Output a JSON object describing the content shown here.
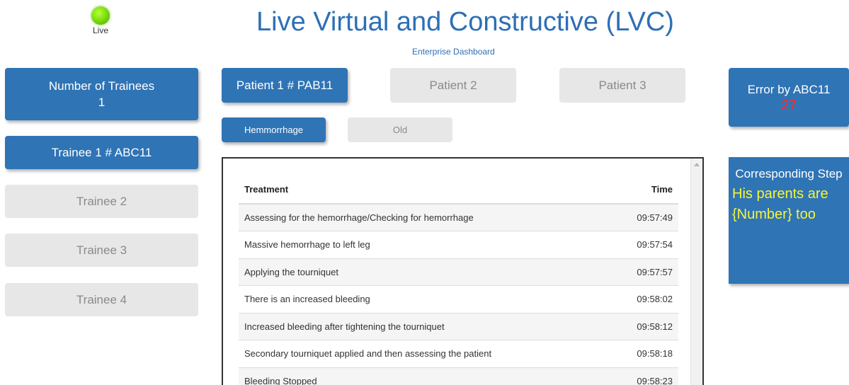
{
  "live": {
    "label": "Live",
    "color": "#7fe010"
  },
  "header": {
    "title": "Live Virtual and Constructive (LVC)",
    "subtitle": "Enterprise Dashboard"
  },
  "trainees": {
    "count_label": "Number of Trainees",
    "count": "1",
    "items": [
      {
        "label": "Trainee 1 # ABC11",
        "active": true
      },
      {
        "label": "Trainee 2",
        "active": false
      },
      {
        "label": "Trainee 3",
        "active": false
      },
      {
        "label": "Trainee 4",
        "active": false
      }
    ]
  },
  "patients": [
    {
      "label": "Patient 1 # PAB11",
      "active": true
    },
    {
      "label": "Patient 2",
      "active": false
    },
    {
      "label": "Patient 3",
      "active": false
    }
  ],
  "subtabs": [
    {
      "label": "Hemmorrhage",
      "active": true
    },
    {
      "label": "Old",
      "active": false
    }
  ],
  "errors": {
    "label": "Error by ABC11",
    "count": "27",
    "count_color": "#ff2a2a"
  },
  "step": {
    "title": "Corresponding Step",
    "text": "His parents are {Number} too",
    "text_color": "#f5f53a"
  },
  "table": {
    "headers": {
      "treatment": "Treatment",
      "time": "Time"
    },
    "rows": [
      {
        "treatment": "Assessing for the hemorrhage/Checking for hemorrhage",
        "time": "09:57:49"
      },
      {
        "treatment": "Massive hemorrhage to left leg",
        "time": "09:57:54"
      },
      {
        "treatment": "Applying the tourniquet",
        "time": "09:57:57"
      },
      {
        "treatment": "There is an increased bleeding",
        "time": "09:58:02"
      },
      {
        "treatment": "Increased bleeding after tightening the tourniquet",
        "time": "09:58:12"
      },
      {
        "treatment": "Secondary tourniquet applied and then assessing the patient",
        "time": "09:58:18"
      },
      {
        "treatment": "Bleeding Stopped",
        "time": "09:58:23"
      }
    ]
  },
  "colors": {
    "accent": "#2f74b5",
    "inactive": "#e7e7e7",
    "title": "#2e6fb5"
  }
}
